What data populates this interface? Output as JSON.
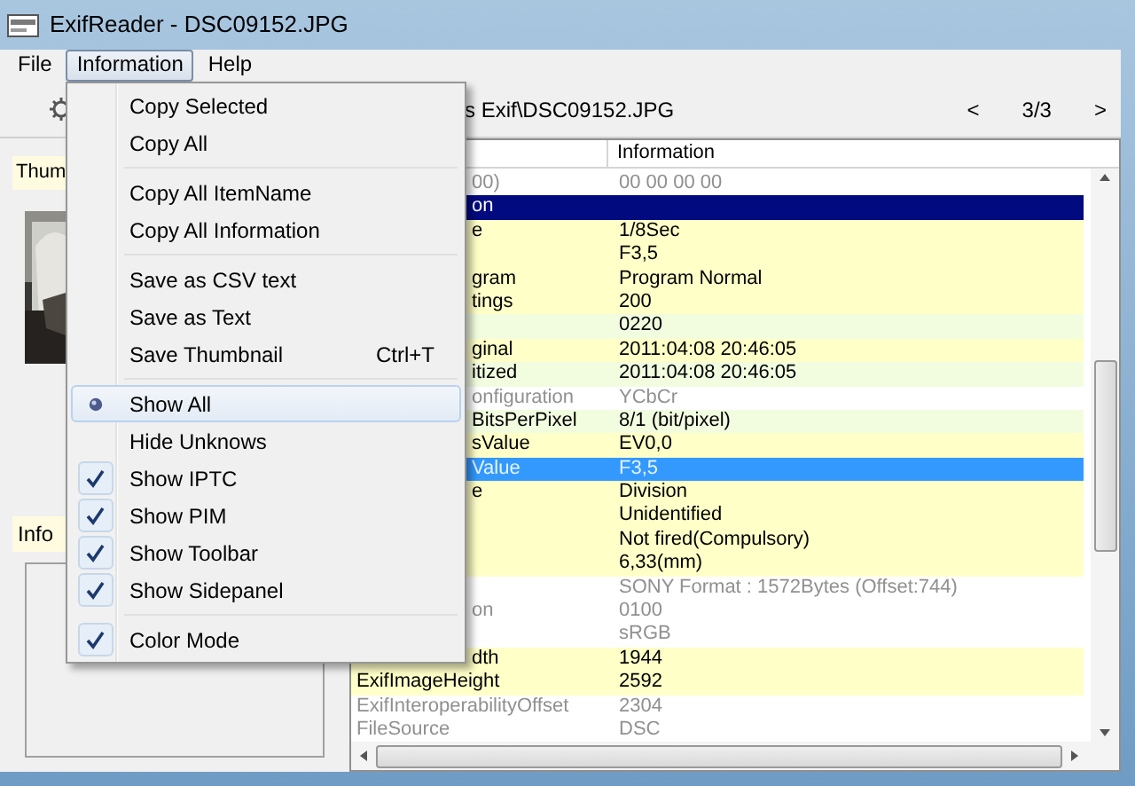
{
  "window": {
    "title": "ExifReader - DSC09152.JPG"
  },
  "menubar": [
    {
      "label": "File",
      "selected": false
    },
    {
      "label": "Information",
      "selected": true
    },
    {
      "label": "Help",
      "selected": false
    }
  ],
  "toolbar": {
    "path": "s Exif\\DSC09152.JPG",
    "prev": "<",
    "counter": "3/3",
    "next": ">"
  },
  "sidepanel": {
    "thumbnail_label": "Thum",
    "info_label": "Info"
  },
  "table": {
    "columns": [
      "Information"
    ],
    "rows": [
      {
        "kind": "unknown",
        "covered": true,
        "selected": false,
        "name": "00)",
        "value": "00 00 00 00"
      },
      {
        "kind": "header",
        "covered": true,
        "selected": false,
        "name": "on",
        "value": ""
      },
      {
        "kind": "main",
        "covered": true,
        "selected": false,
        "name": "e",
        "value": "1/8Sec"
      },
      {
        "kind": "main",
        "selected": false,
        "name": "",
        "value": "F3,5"
      },
      {
        "kind": "main",
        "covered": true,
        "selected": false,
        "name": "gram",
        "value": "Program Normal"
      },
      {
        "kind": "main",
        "covered": true,
        "selected": false,
        "name": "tings",
        "value": "200"
      },
      {
        "kind": "sub",
        "selected": false,
        "name": "",
        "value": "0220"
      },
      {
        "kind": "main",
        "covered": true,
        "selected": false,
        "name": "ginal",
        "value": "2011:04:08 20:46:05"
      },
      {
        "kind": "sub",
        "covered": true,
        "selected": false,
        "name": "itized",
        "value": "2011:04:08 20:46:05"
      },
      {
        "kind": "unknown",
        "covered": true,
        "selected": false,
        "name": "onfiguration",
        "value": "YCbCr"
      },
      {
        "kind": "sub",
        "covered": true,
        "selected": false,
        "name": "BitsPerPixel",
        "value": "8/1 (bit/pixel)"
      },
      {
        "kind": "main",
        "covered": true,
        "selected": false,
        "name": "sValue",
        "value": "EV0,0"
      },
      {
        "kind": "main",
        "covered": true,
        "selected": true,
        "name": "Value",
        "value": "F3,5"
      },
      {
        "kind": "main",
        "covered": true,
        "selected": false,
        "name": "e",
        "value": "Division"
      },
      {
        "kind": "main",
        "selected": false,
        "name": "",
        "value": "Unidentified"
      },
      {
        "kind": "main",
        "selected": false,
        "name": "",
        "value": "Not fired(Compulsory)"
      },
      {
        "kind": "main",
        "selected": false,
        "name": "",
        "value": "6,33(mm)"
      },
      {
        "kind": "unknown",
        "selected": false,
        "name": "",
        "value": "SONY Format : 1572Bytes (Offset:744)"
      },
      {
        "kind": "unknown",
        "covered": true,
        "selected": false,
        "name": "on",
        "value": "0100"
      },
      {
        "kind": "unknown",
        "selected": false,
        "name": "",
        "value": "sRGB"
      },
      {
        "kind": "main",
        "covered": true,
        "selected": false,
        "name": "dth",
        "value": "1944"
      },
      {
        "kind": "main",
        "covered": false,
        "selected": false,
        "name": "ExifImageHeight",
        "value": "2592"
      },
      {
        "kind": "unknown",
        "covered": false,
        "selected": false,
        "name": "ExifInteroperabilityOffset",
        "value": "2304"
      },
      {
        "kind": "unknown",
        "covered": false,
        "selected": false,
        "name": "FileSource",
        "value": "DSC"
      }
    ]
  },
  "menu": [
    {
      "kind": "item",
      "label": "Copy Selected",
      "selected": false
    },
    {
      "kind": "item",
      "label": "Copy All",
      "selected": false
    },
    {
      "kind": "separator"
    },
    {
      "kind": "item",
      "label": "Copy All ItemName",
      "selected": false
    },
    {
      "kind": "item",
      "label": "Copy All Information",
      "selected": false
    },
    {
      "kind": "separator"
    },
    {
      "kind": "item",
      "label": "Save as CSV text",
      "selected": false
    },
    {
      "kind": "item",
      "label": "Save as Text",
      "selected": false
    },
    {
      "kind": "item",
      "label": "Save Thumbnail",
      "shortcut": "Ctrl+T",
      "selected": false
    },
    {
      "kind": "separator"
    },
    {
      "kind": "radio",
      "label": "Show All",
      "checked": true,
      "selected": true
    },
    {
      "kind": "check",
      "label": "Hide Unknows",
      "checked": false,
      "selected": false
    },
    {
      "kind": "check",
      "label": "Show IPTC",
      "checked": true,
      "selected": false
    },
    {
      "kind": "check",
      "label": "Show PIM",
      "checked": true,
      "selected": false
    },
    {
      "kind": "check",
      "label": "Show Toolbar",
      "checked": true,
      "selected": false
    },
    {
      "kind": "check",
      "label": "Show Sidepanel",
      "checked": true,
      "selected": false
    },
    {
      "kind": "separator"
    },
    {
      "kind": "check",
      "label": "Color Mode",
      "checked": true,
      "selected": false
    }
  ]
}
